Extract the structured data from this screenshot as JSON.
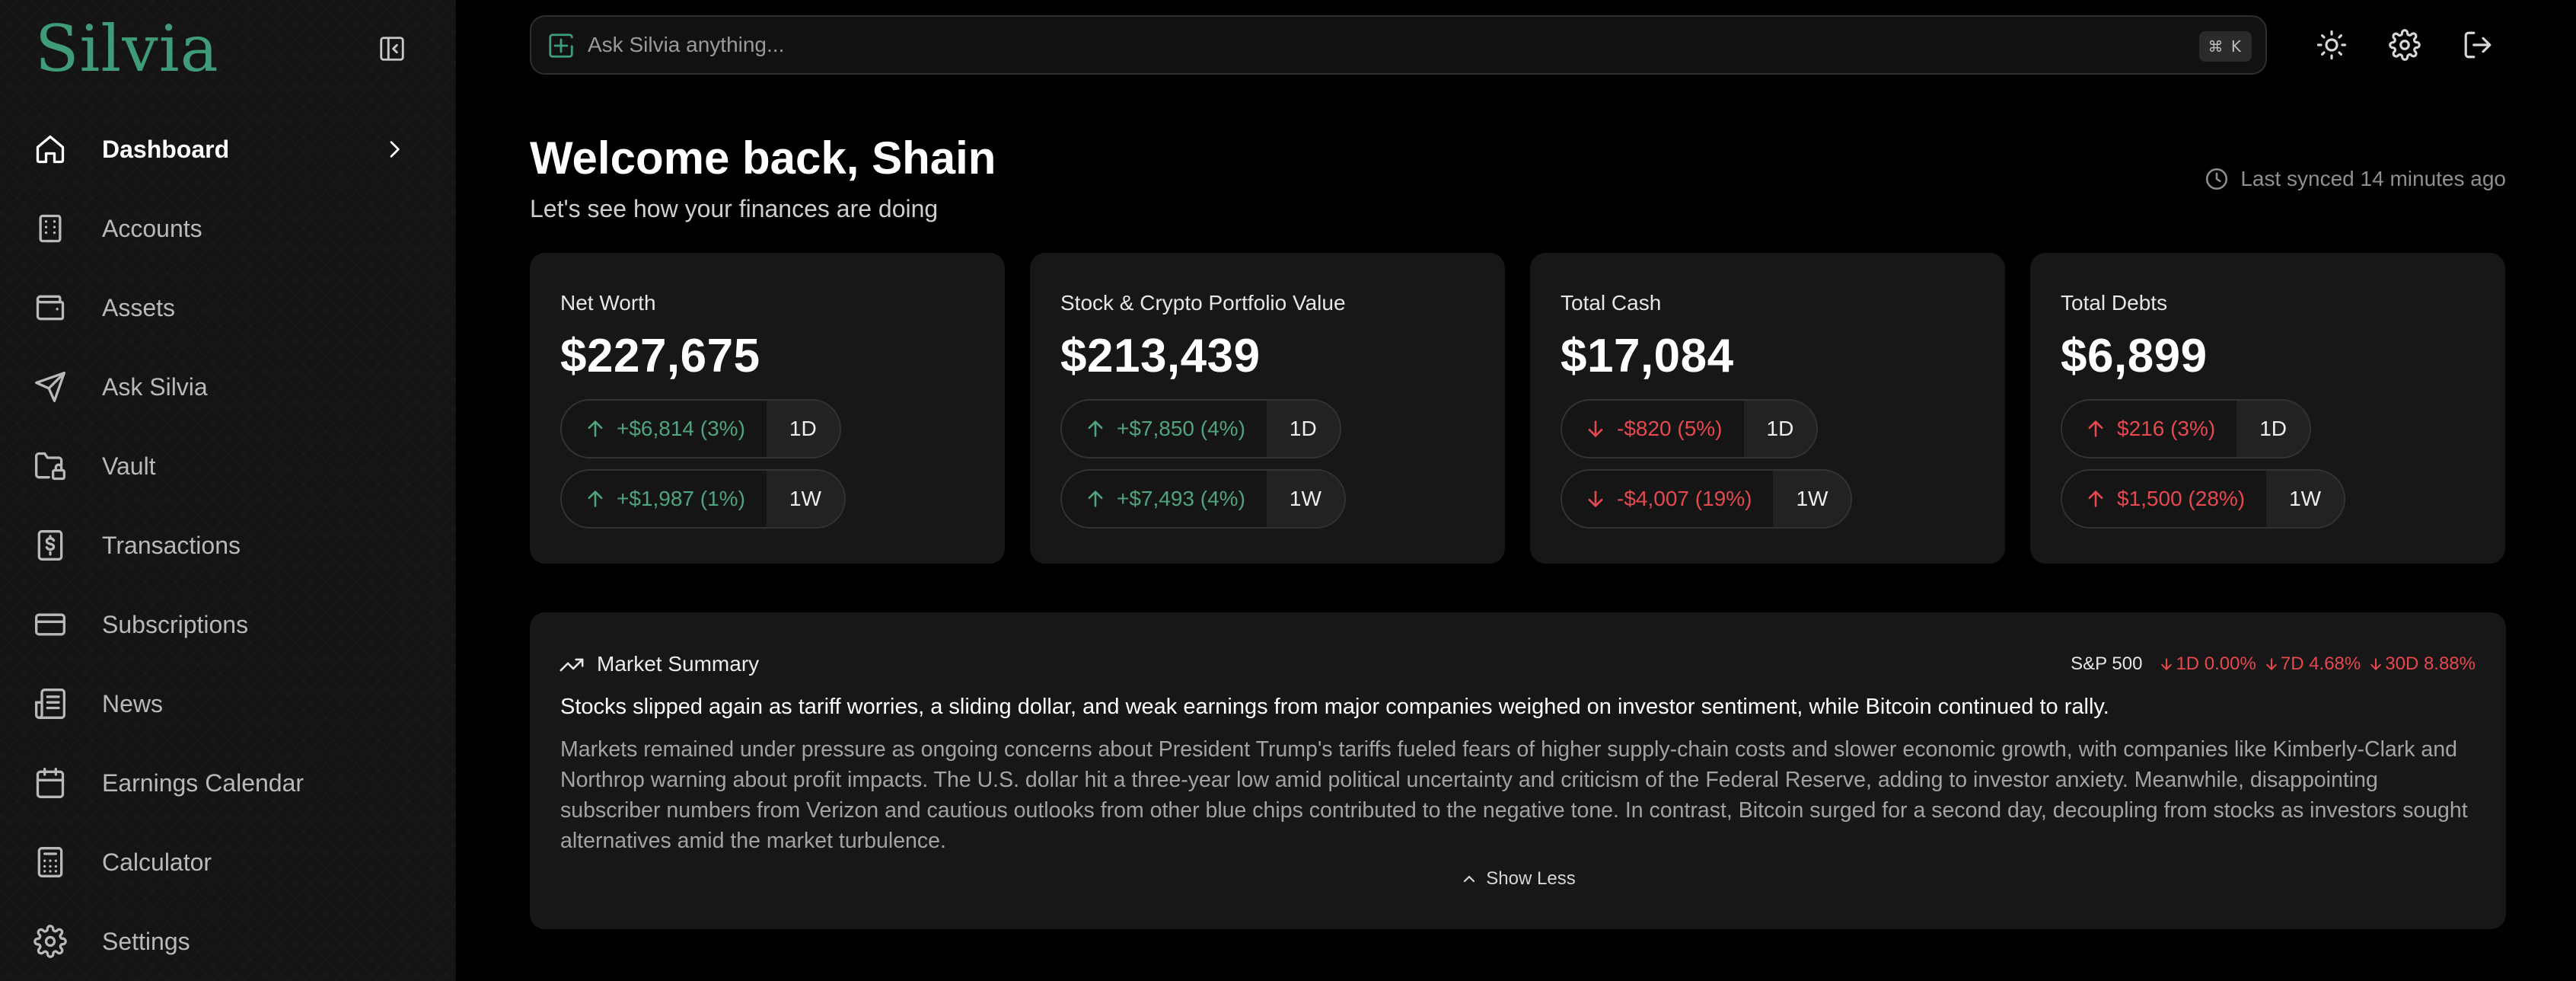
{
  "app": {
    "logo": "Silvia"
  },
  "sidebar": {
    "items": [
      {
        "label": "Dashboard",
        "icon": "home-icon",
        "active": true
      },
      {
        "label": "Accounts",
        "icon": "building-icon"
      },
      {
        "label": "Assets",
        "icon": "wallet-icon"
      },
      {
        "label": "Ask Silvia",
        "icon": "send-icon"
      },
      {
        "label": "Vault",
        "icon": "folder-lock-icon"
      },
      {
        "label": "Transactions",
        "icon": "dollar-receipt-icon"
      },
      {
        "label": "Subscriptions",
        "icon": "credit-card-icon"
      },
      {
        "label": "News",
        "icon": "newspaper-icon"
      },
      {
        "label": "Earnings Calendar",
        "icon": "calendar-icon"
      },
      {
        "label": "Calculator",
        "icon": "calculator-icon"
      },
      {
        "label": "Settings",
        "icon": "gear-icon"
      }
    ]
  },
  "header": {
    "search_placeholder": "Ask Silvia anything...",
    "shortcut": "⌘ K"
  },
  "welcome": {
    "title": "Welcome back, Shain",
    "subtitle": "Let's see how your finances are doing",
    "synced": "Last synced 14 minutes ago"
  },
  "cards": [
    {
      "label": "Net Worth",
      "value": "$227,675",
      "changes": [
        {
          "text": "+$6,814 (3%)",
          "period": "1D",
          "dir": "up",
          "tone": "pos"
        },
        {
          "text": "+$1,987 (1%)",
          "period": "1W",
          "dir": "up",
          "tone": "pos"
        }
      ]
    },
    {
      "label": "Stock & Crypto Portfolio Value",
      "value": "$213,439",
      "changes": [
        {
          "text": "+$7,850 (4%)",
          "period": "1D",
          "dir": "up",
          "tone": "pos"
        },
        {
          "text": "+$7,493 (4%)",
          "period": "1W",
          "dir": "up",
          "tone": "pos"
        }
      ]
    },
    {
      "label": "Total Cash",
      "value": "$17,084",
      "changes": [
        {
          "text": "-$820 (5%)",
          "period": "1D",
          "dir": "down",
          "tone": "neg"
        },
        {
          "text": "-$4,007 (19%)",
          "period": "1W",
          "dir": "down",
          "tone": "neg"
        }
      ]
    },
    {
      "label": "Total Debts",
      "value": "$6,899",
      "changes": [
        {
          "text": "$216 (3%)",
          "period": "1D",
          "dir": "up",
          "tone": "neg"
        },
        {
          "text": "$1,500 (28%)",
          "period": "1W",
          "dir": "up",
          "tone": "neg"
        }
      ]
    }
  ],
  "market": {
    "title": "Market Summary",
    "index_label": "S&P 500",
    "stats": [
      "1D 0.00%",
      "7D 4.68%",
      "30D 8.88%"
    ],
    "headline": "Stocks slipped again as tariff worries, a sliding dollar, and weak earnings from major companies weighed on investor sentiment, while Bitcoin continued to rally.",
    "body": "Markets remained under pressure as ongoing concerns about President Trump's tariffs fueled fears of higher supply-chain costs and slower economic growth, with companies like Kimberly-Clark and Northrop warning about profit impacts. The U.S. dollar hit a three-year low amid political uncertainty and criticism of the Federal Reserve, adding to investor anxiety. Meanwhile, disappointing subscriber numbers from Verizon and cautious outlooks from other blue chips contributed to the negative tone. In contrast, Bitcoin surged for a second day, decoupling from stocks as investors sought alternatives amid the market turbulence.",
    "show_less": "Show Less"
  },
  "colors": {
    "accent": "#3f9b78",
    "positive": "#4fa37d",
    "negative": "#e5484d",
    "background": "#000000",
    "card": "#171717"
  }
}
